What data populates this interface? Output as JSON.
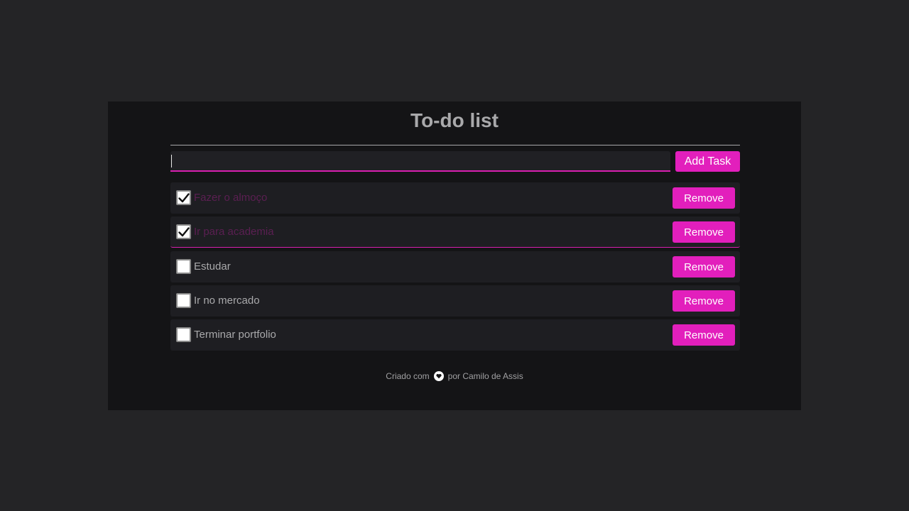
{
  "app": {
    "title": "To-do list"
  },
  "input": {
    "value": "",
    "placeholder": ""
  },
  "add_button": {
    "label": "Add Task"
  },
  "tasks": [
    {
      "label": "Fazer o almoço",
      "done": true,
      "remove_label": "Remove"
    },
    {
      "label": "Ir para academia",
      "done": true,
      "remove_label": "Remove"
    },
    {
      "label": "Estudar",
      "done": false,
      "remove_label": "Remove"
    },
    {
      "label": "Ir no mercado",
      "done": false,
      "remove_label": "Remove"
    },
    {
      "label": "Terminar portfolio",
      "done": false,
      "remove_label": "Remove"
    }
  ],
  "footer": {
    "prefix": "Criado com",
    "icon": "heart-icon",
    "suffix": "por Camilo de Assis"
  },
  "colors": {
    "background": "#242426",
    "card": "#141416",
    "row": "#1e1e22",
    "accent": "#e21fbc",
    "done_text": "#5b1f52",
    "text": "#a9a9ab"
  }
}
